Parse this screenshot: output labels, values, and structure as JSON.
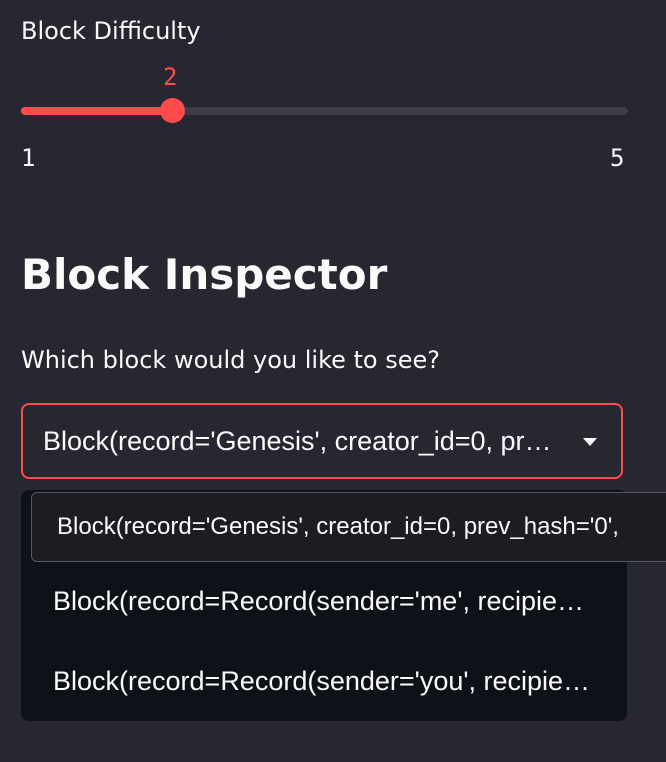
{
  "slider": {
    "label": "Block Difficulty",
    "value": "2",
    "min": "1",
    "max": "5",
    "fill_fraction": 0.25,
    "accent_color": "#ff4b4b"
  },
  "inspector": {
    "title": "Block Inspector",
    "select_label": "Which block would you like to see?",
    "selected_value": "Block(record='Genesis', creator_id=0, prev_hash='0',",
    "chevron_icon": "chevron-down-icon",
    "tooltip_text": "Block(record='Genesis', creator_id=0, prev_hash='0',",
    "options": [
      "Block(record=Record(sender='me', recipient='you', amount=",
      "Block(record=Record(sender='you', recipient='me', amount="
    ]
  }
}
